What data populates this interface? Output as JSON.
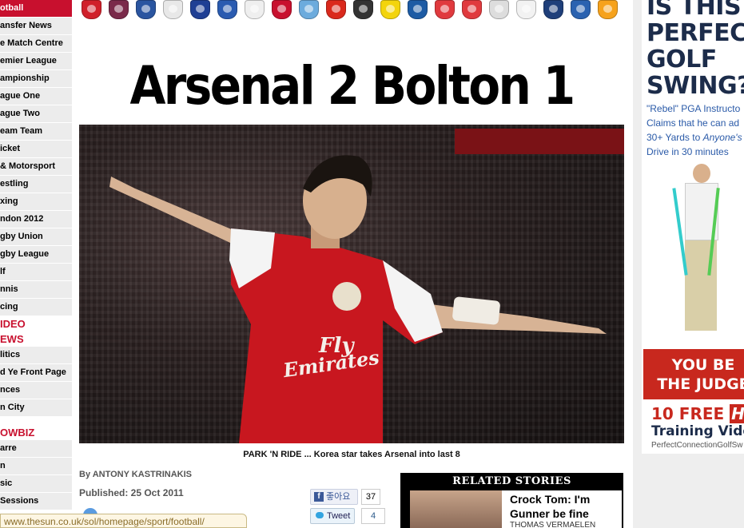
{
  "sidebar": {
    "items": [
      {
        "label": "otball",
        "style": "header-red"
      },
      {
        "label": "ansfer News"
      },
      {
        "label": "e Match Centre"
      },
      {
        "label": "emier League"
      },
      {
        "label": "ampionship"
      },
      {
        "label": "ague One"
      },
      {
        "label": "ague Two"
      },
      {
        "label": "eam Team"
      },
      {
        "label": "icket"
      },
      {
        "label": "& Motorsport"
      },
      {
        "label": "estling"
      },
      {
        "label": "xing"
      },
      {
        "label": "ndon 2012"
      },
      {
        "label": "gby Union"
      },
      {
        "label": "gby League"
      },
      {
        "label": "lf"
      },
      {
        "label": "nnis"
      },
      {
        "label": "cing"
      }
    ],
    "video_label": "IDEO",
    "news_label": "EWS",
    "news_items": [
      {
        "label": "litics"
      },
      {
        "label": "d Ye Front Page"
      },
      {
        "label": "nces"
      },
      {
        "label": "n City"
      }
    ],
    "showbiz_label": "OWBIZ",
    "showbiz_items": [
      {
        "label": "arre"
      },
      {
        "label": "n"
      },
      {
        "label": "sic"
      },
      {
        "label": " Sessions"
      }
    ]
  },
  "crests": [
    {
      "name": "arsenal-crest-icon",
      "color": "#d0202a"
    },
    {
      "name": "aston-villa-crest-icon",
      "color": "#7a2a4a"
    },
    {
      "name": "blackburn-crest-icon",
      "color": "#2a55a0"
    },
    {
      "name": "bolton-crest-icon",
      "color": "#e8e8e8"
    },
    {
      "name": "chelsea-crest-icon",
      "color": "#1f3f94"
    },
    {
      "name": "everton-crest-icon",
      "color": "#2a5bb0"
    },
    {
      "name": "fulham-crest-icon",
      "color": "#efefef"
    },
    {
      "name": "liverpool-crest-icon",
      "color": "#c8102e"
    },
    {
      "name": "man-city-crest-icon",
      "color": "#6cabdd"
    },
    {
      "name": "man-utd-crest-icon",
      "color": "#da291c"
    },
    {
      "name": "newcastle-crest-icon",
      "color": "#333333"
    },
    {
      "name": "norwich-crest-icon",
      "color": "#f3d40c"
    },
    {
      "name": "qpr-crest-icon",
      "color": "#1d5ba4"
    },
    {
      "name": "stoke-crest-icon",
      "color": "#e03a3e"
    },
    {
      "name": "sunderland-crest-icon",
      "color": "#e03a3e"
    },
    {
      "name": "swansea-crest-icon",
      "color": "#dddddd"
    },
    {
      "name": "tottenham-crest-icon",
      "color": "#f2f2f2"
    },
    {
      "name": "west-brom-crest-icon",
      "color": "#1f3f7a"
    },
    {
      "name": "wigan-crest-icon",
      "color": "#2a62b0"
    },
    {
      "name": "wolves-crest-icon",
      "color": "#f6a21c"
    }
  ],
  "article": {
    "headline": "Arsenal 2 Bolton 1",
    "caption": "PARK 'N RIDE ... Korea star takes Arsenal into last 8",
    "byline": "By ANTONY KASTRINAKIS",
    "published": "Published: 25 Oct 2011",
    "fb_label": "좋아요",
    "fb_count": "37",
    "tweet_label": "Tweet",
    "tweet_count": "4"
  },
  "related": {
    "title": "RELATED STORIES",
    "headline": "Crock Tom: I'm Gunner be fine",
    "sub": "THOMAS VERMAELEN"
  },
  "ad": {
    "headline": "IS THIS TH\nPERFEC\nGOLF\nSWING?",
    "body_line1": "\"Rebel\" PGA Instructo",
    "body_line2": "Claims that he can ad",
    "body_line3a": "30+ Yards to ",
    "body_line3b": "Anyone's",
    "body_line4": "Drive in 30 minutes",
    "red_line1": "YOU BE",
    "red_line2": "THE JUDGE",
    "free_a": "10 FREE ",
    "free_b": "HD",
    "training": "Training Video",
    "url": "PerfectConnectionGolfSw"
  },
  "status_bar": {
    "url": "www.thesun.co.uk/sol/homepage/sport/football/"
  }
}
